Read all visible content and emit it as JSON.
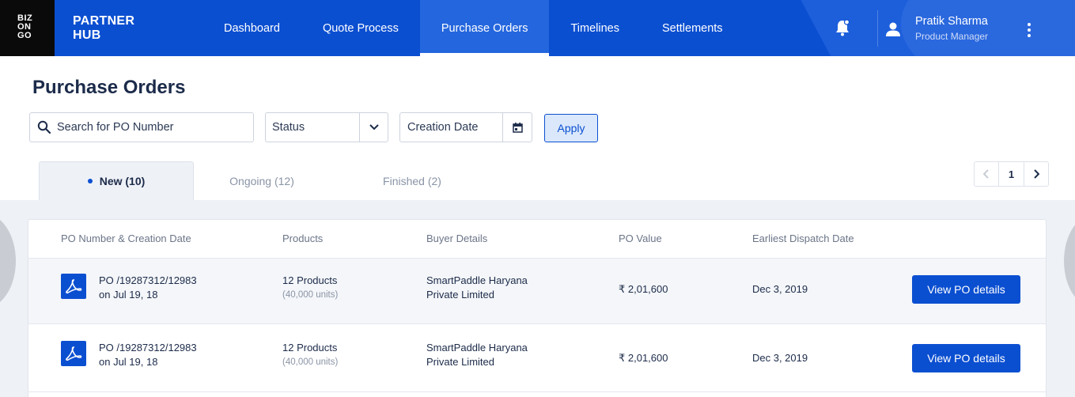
{
  "app": {
    "logo_lines": [
      "BIZ",
      "ON",
      "GO"
    ],
    "brand_line1": "PARTNER",
    "brand_line2": "HUB"
  },
  "nav": {
    "items": [
      {
        "label": "Dashboard",
        "active": false
      },
      {
        "label": "Quote Process",
        "active": false
      },
      {
        "label": "Purchase Orders",
        "active": true
      },
      {
        "label": "Timelines",
        "active": false
      },
      {
        "label": "Settlements",
        "active": false
      }
    ]
  },
  "user": {
    "name": "Pratik Sharma",
    "role": "Product Manager"
  },
  "page": {
    "title": "Purchase Orders"
  },
  "filters": {
    "search_placeholder": "Search for PO Number",
    "status_label": "Status",
    "date_label": "Creation Date",
    "apply_label": "Apply"
  },
  "tabs": [
    {
      "label": "New (10)",
      "active": true
    },
    {
      "label": "Ongoing (12)",
      "active": false
    },
    {
      "label": "Finished (2)",
      "active": false
    }
  ],
  "pagination": {
    "current_page": "1"
  },
  "table": {
    "headers": {
      "po": "PO Number & Creation Date",
      "products": "Products",
      "buyer": "Buyer Details",
      "value": "PO Value",
      "dispatch": "Earliest Dispatch Date"
    },
    "rows": [
      {
        "po_number": "PO /19287312/12983",
        "created": "on Jul 19, 18",
        "products": "12 Products",
        "units": "(40,000 units)",
        "buyer_line1": "SmartPaddle Haryana",
        "buyer_line2": "Private Limited",
        "value": "₹ 2,01,600",
        "dispatch": "Dec 3, 2019",
        "action": "View PO details"
      },
      {
        "po_number": "PO /19287312/12983",
        "created": "on Jul 19, 18",
        "products": "12 Products",
        "units": "(40,000 units)",
        "buyer_line1": "SmartPaddle Haryana",
        "buyer_line2": "Private Limited",
        "value": "₹ 2,01,600",
        "dispatch": "Dec 3, 2019",
        "action": "View PO details"
      }
    ]
  },
  "colors": {
    "primary": "#0b4fd1",
    "nav_active": "#2466dd",
    "logo_bg": "#0a0a0a",
    "page_bg": "#eef1f6",
    "text_dark": "#1c2b4a",
    "text_muted": "#8a94a6"
  },
  "icons": {
    "bell": "bell-icon",
    "user": "user-icon",
    "more": "kebab-menu-icon",
    "search": "search-icon",
    "chevron": "chevron-down-icon",
    "calendar": "calendar-icon",
    "pdf": "pdf-icon"
  }
}
